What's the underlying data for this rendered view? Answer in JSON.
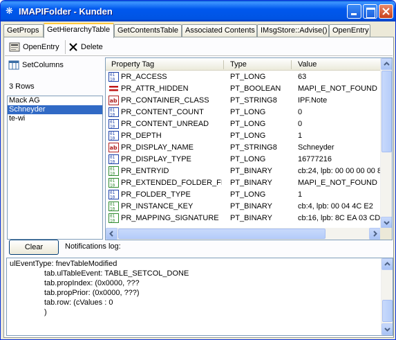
{
  "window": {
    "title": "IMAPIFolder - Kunden"
  },
  "tabs": [
    "GetProps",
    "GetHierarchyTable",
    "GetContentsTable",
    "Associated Contents",
    "IMsgStore::Advise()",
    "OpenEntry"
  ],
  "toolbar": {
    "open_entry": "OpenEntry",
    "delete": "Delete"
  },
  "left": {
    "set_columns": "SetColumns",
    "rows_count": "3 Rows",
    "rows": [
      "Mack AG",
      "Schneyder",
      "te-wi"
    ],
    "selected_index": 1
  },
  "grid": {
    "headers": {
      "tag": "Property Tag",
      "type": "Type",
      "value": "Value"
    },
    "rows": [
      {
        "icon": "long-icon",
        "tag": "PR_ACCESS",
        "type": "PT_LONG",
        "value": "63"
      },
      {
        "icon": "boolean-icon",
        "tag": "PR_ATTR_HIDDEN",
        "type": "PT_BOOLEAN",
        "value": "MAPI_E_NOT_FOUND"
      },
      {
        "icon": "string-icon",
        "tag": "PR_CONTAINER_CLASS",
        "type": "PT_STRING8",
        "value": "IPF.Note"
      },
      {
        "icon": "long-icon",
        "tag": "PR_CONTENT_COUNT",
        "type": "PT_LONG",
        "value": "0"
      },
      {
        "icon": "long-icon",
        "tag": "PR_CONTENT_UNREAD",
        "type": "PT_LONG",
        "value": "0"
      },
      {
        "icon": "long-icon",
        "tag": "PR_DEPTH",
        "type": "PT_LONG",
        "value": "1"
      },
      {
        "icon": "string-icon",
        "tag": "PR_DISPLAY_NAME",
        "type": "PT_STRING8",
        "value": "Schneyder"
      },
      {
        "icon": "long-icon",
        "tag": "PR_DISPLAY_TYPE",
        "type": "PT_LONG",
        "value": "16777216"
      },
      {
        "icon": "binary-icon",
        "tag": "PR_ENTRYID",
        "type": "PT_BINARY",
        "value": "cb:24, lpb: 00 00 00 00 8"
      },
      {
        "icon": "binary-icon",
        "tag": "PR_EXTENDED_FOLDER_FL...",
        "type": "PT_BINARY",
        "value": "MAPI_E_NOT_FOUND"
      },
      {
        "icon": "long-icon",
        "tag": "PR_FOLDER_TYPE",
        "type": "PT_LONG",
        "value": "1"
      },
      {
        "icon": "binary-icon",
        "tag": "PR_INSTANCE_KEY",
        "type": "PT_BINARY",
        "value": "cb:4, lpb: 00 04 4C E2"
      },
      {
        "icon": "binary-icon",
        "tag": "PR_MAPPING_SIGNATURE",
        "type": "PT_BINARY",
        "value": "cb:16, lpb: 8C EA 03 CD E"
      }
    ]
  },
  "notifications": {
    "clear_label": "Clear",
    "log_label": "Notifications log:",
    "lines": [
      "ulEventType: fnevTableModified",
      "tab.ulTableEvent: TABLE_SETCOL_DONE",
      "tab.propIndex: (0x0000, ???",
      "tab.propPrior: (0x0000, ???)",
      "tab.row: (cValues : 0",
      ")"
    ]
  },
  "colors": {
    "accent": "#0054e3",
    "selection": "#316ac5",
    "tab_highlight": "#ffc83c"
  }
}
